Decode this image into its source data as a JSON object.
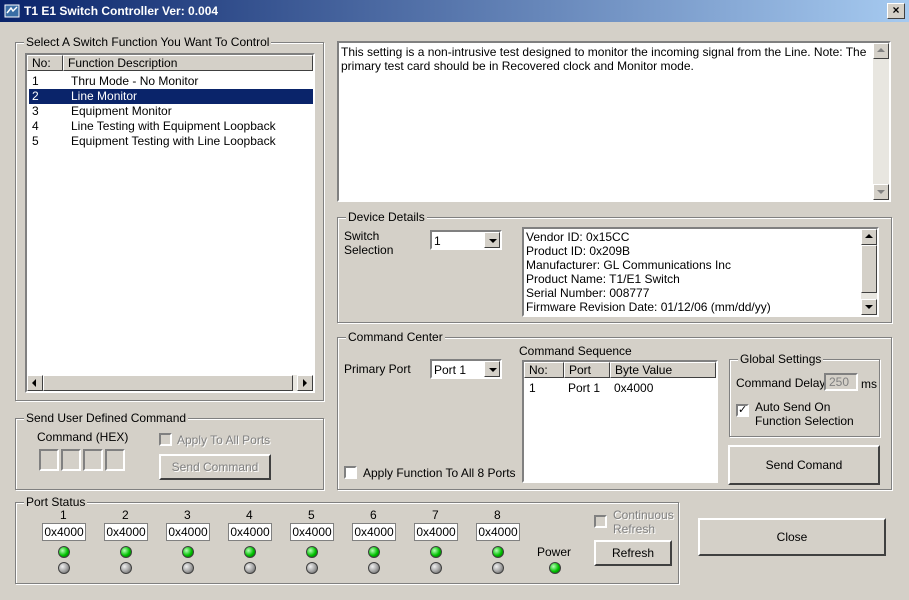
{
  "window": {
    "title": "T1 E1 Switch Controller Ver: 0.004",
    "close_glyph": "×"
  },
  "function_group": {
    "legend": "Select A Switch Function You Want To Control",
    "headers": [
      "No:",
      "Function Description"
    ],
    "rows": [
      {
        "no": "1",
        "desc": "Thru Mode - No Monitor"
      },
      {
        "no": "2",
        "desc": "Line Monitor"
      },
      {
        "no": "3",
        "desc": "Equipment Monitor"
      },
      {
        "no": "4",
        "desc": "Line Testing with Equipment Loopback"
      },
      {
        "no": "5",
        "desc": "Equipment Testing with Line Loopback"
      }
    ],
    "selected_index": 1
  },
  "description": "This setting is a non-intrusive test designed to monitor the incoming signal from the Line.   Note: The primary test card should be in Recovered clock and Monitor mode.",
  "device": {
    "legend": "Device Details",
    "switch_label_1": "Switch",
    "switch_label_2": "Selection",
    "switch_value": "1",
    "details": [
      "Vendor ID: 0x15CC",
      "Product ID: 0x209B",
      "Manufacturer: GL Communications Inc",
      "Product Name: T1/E1 Switch",
      "Serial Number: 008777",
      "Firmware Revision Date: 01/12/06 (mm/dd/yy)"
    ]
  },
  "command_center": {
    "legend": "Command Center",
    "primary_port_label": "Primary Port",
    "primary_port_value": "Port 1",
    "sequence_label": "Command Sequence",
    "sequence_headers": [
      "No:",
      "Port",
      "Byte Value"
    ],
    "sequence_rows": [
      {
        "no": "1",
        "port": "Port 1",
        "value": "0x4000"
      }
    ],
    "apply_all_label": "Apply Function To All 8 Ports",
    "global_legend": "Global Settings",
    "delay_label": "Command Delay",
    "delay_value": "250",
    "delay_unit": "ms",
    "auto_send_label_1": "Auto Send On",
    "auto_send_label_2": "Function Selection",
    "auto_send_checked": "✓",
    "send_button": "Send Comand"
  },
  "user_cmd": {
    "legend": "Send User Defined Command",
    "command_label": "Command (HEX)",
    "apply_all_ports": "Apply To All Ports",
    "send_button": "Send Command"
  },
  "port_status": {
    "legend": "Port Status",
    "ports": [
      {
        "num": "1",
        "value": "0x4000"
      },
      {
        "num": "2",
        "value": "0x4000"
      },
      {
        "num": "3",
        "value": "0x4000"
      },
      {
        "num": "4",
        "value": "0x4000"
      },
      {
        "num": "5",
        "value": "0x4000"
      },
      {
        "num": "6",
        "value": "0x4000"
      },
      {
        "num": "7",
        "value": "0x4000"
      },
      {
        "num": "8",
        "value": "0x4000"
      }
    ],
    "power_label": "Power",
    "continuous_1": "Continuous",
    "continuous_2": "Refresh",
    "refresh_button": "Refresh"
  },
  "close_button": "Close",
  "colors": {
    "face": "#d4d0c8",
    "selection": "#0a246a",
    "led_on": "#00c000",
    "led_off": "#a0a0a0"
  }
}
